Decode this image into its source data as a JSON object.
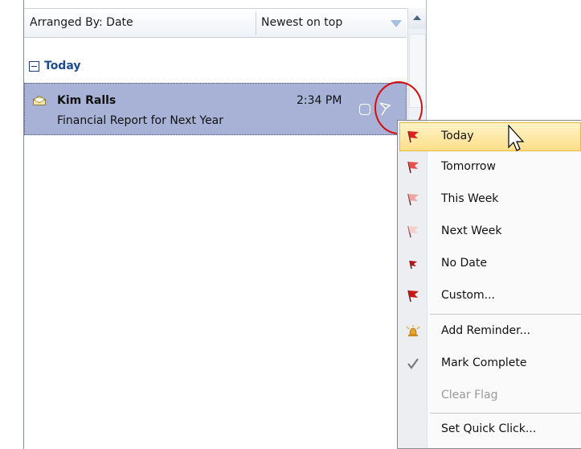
{
  "header": {
    "arranged_by": "Arranged By: Date",
    "sort_order": "Newest on top"
  },
  "group": {
    "label": "Today"
  },
  "message": {
    "from": "Kim Ralls",
    "time": "2:34 PM",
    "subject": "Financial Report for Next Year",
    "icon": "envelope-read-icon"
  },
  "menu": {
    "items": [
      {
        "label": "Today",
        "icon": "flag-red-icon"
      },
      {
        "label": "Tomorrow",
        "icon": "flag-red-icon"
      },
      {
        "label": "This Week",
        "icon": "flag-pink-icon"
      },
      {
        "label": "Next Week",
        "icon": "flag-light-icon"
      },
      {
        "label": "No Date",
        "icon": "flag-small-icon"
      },
      {
        "label": "Custom...",
        "icon": "flag-custom-icon"
      },
      {
        "label": "Add Reminder...",
        "icon": "bell-icon"
      },
      {
        "label": "Mark Complete",
        "icon": "checkmark-icon"
      },
      {
        "label": "Clear Flag",
        "icon": "none"
      },
      {
        "label": "Set Quick Click...",
        "icon": "none"
      }
    ]
  },
  "colors": {
    "selected_row": "#a8b2d6",
    "group_text": "#1e4b8f",
    "highlight": "#d40f0f",
    "menu_hover": "#fddf8a"
  }
}
